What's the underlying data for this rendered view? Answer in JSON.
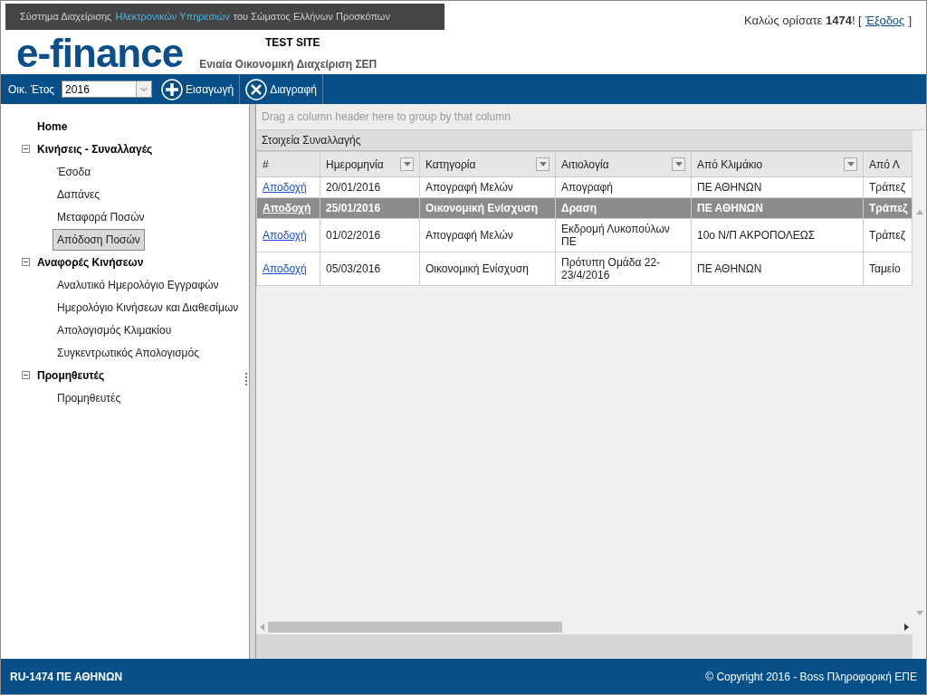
{
  "banner": [
    {
      "text": "Σύστημα Διαχείρισης",
      "highlighted": false
    },
    {
      "text": "Ηλεκτρονικών Υπηρεσιών",
      "highlighted": true
    },
    {
      "text": "του Σώματος Ελλήνων Προσκόπων",
      "highlighted": false
    }
  ],
  "logo": "e-finance",
  "site_label": "TEST SITE",
  "subtitle": "Ενιαία Οικονομική Διαχείριση ΣΕΠ",
  "welcome": {
    "text": "Καλώς ορίσατε **1474**! [",
    "logout": "Έξοδος",
    "close": "]"
  },
  "toolbar": {
    "year_label": "Οικ. Έτος",
    "year_value": "2016",
    "buttons": [
      {
        "kind": "add",
        "label": "Εισαγωγή"
      },
      {
        "kind": "delete",
        "label": "Διαγραφή"
      }
    ]
  },
  "sidebar": {
    "items": [
      {
        "label": "Home",
        "selected": false
      },
      {
        "label": "Κινήσεις - Συναλλαγές",
        "expanded": true,
        "children": [
          {
            "label": "Έσοδα",
            "selected": false
          },
          {
            "label": "Δαπάνες",
            "selected": false
          },
          {
            "label": "Μεταφορά Ποσών",
            "selected": false
          },
          {
            "label": "Απόδοση Ποσών",
            "selected": true
          }
        ]
      },
      {
        "label": "Αναφορές Κινήσεων",
        "expanded": true,
        "children": [
          {
            "label": "Αναλυτικό Ημερολόγιο Εγγραφών",
            "selected": false
          },
          {
            "label": "Ημερολόγιο Κινήσεων και Διαθεσίμων",
            "selected": false
          },
          {
            "label": "Απολογισμός Κλιμακίου",
            "selected": false
          },
          {
            "label": "Συγκεντρωτικός Απολογισμός",
            "selected": false
          }
        ]
      },
      {
        "label": "Προμηθευτές",
        "expanded": true,
        "children": [
          {
            "label": "Προμηθευτές",
            "selected": false
          }
        ]
      }
    ]
  },
  "grid": {
    "group_hint": "Drag a column header here to group by that column",
    "band": "Στοιχεία Συναλλαγής",
    "columns": [
      {
        "label": "#",
        "filter": false
      },
      {
        "label": "Ημερομηνία",
        "filter": true
      },
      {
        "label": "Κατηγορία",
        "filter": true
      },
      {
        "label": "Αιτιολογία",
        "filter": true
      },
      {
        "label": "Από Κλιμάκιο",
        "filter": true
      },
      {
        "label": "Από Λ",
        "filter": false
      }
    ],
    "rows": [
      {
        "selected": false,
        "cells": [
          "Αποδοχή",
          "20/01/2016",
          "Απογραφή Μελών",
          "Απογραφή",
          "ΠΕ ΑΘΗΝΩΝ",
          "Τράπεζ"
        ]
      },
      {
        "selected": true,
        "cells": [
          "Αποδοχή",
          "25/01/2016",
          "Οικονομική Ενίσχυση",
          "Δραση",
          "ΠΕ ΑΘΗΝΩΝ",
          "Τράπεζ"
        ]
      },
      {
        "selected": false,
        "cells": [
          "Αποδοχή",
          "01/02/2016",
          "Απογραφή Μελών",
          "Εκδρομή Λυκοπούλων ΠΕ",
          "10ο Ν/Π ΑΚΡΟΠΟΛΕΩΣ",
          "Τράπεζ"
        ]
      },
      {
        "selected": false,
        "cells": [
          "Αποδοχή",
          "05/03/2016",
          "Οικονομική Ενίσχυση",
          "Πρότυπη Ομάδα 22-23/4/2016",
          "ΠΕ ΑΘΗΝΩΝ",
          "Ταμείο"
        ]
      }
    ]
  },
  "footer": {
    "left": "RU-1474 ΠΕ ΑΘΗΝΩΝ",
    "right": "© Copyright 2016 - Boss Πληροφορική ΕΠΕ"
  }
}
